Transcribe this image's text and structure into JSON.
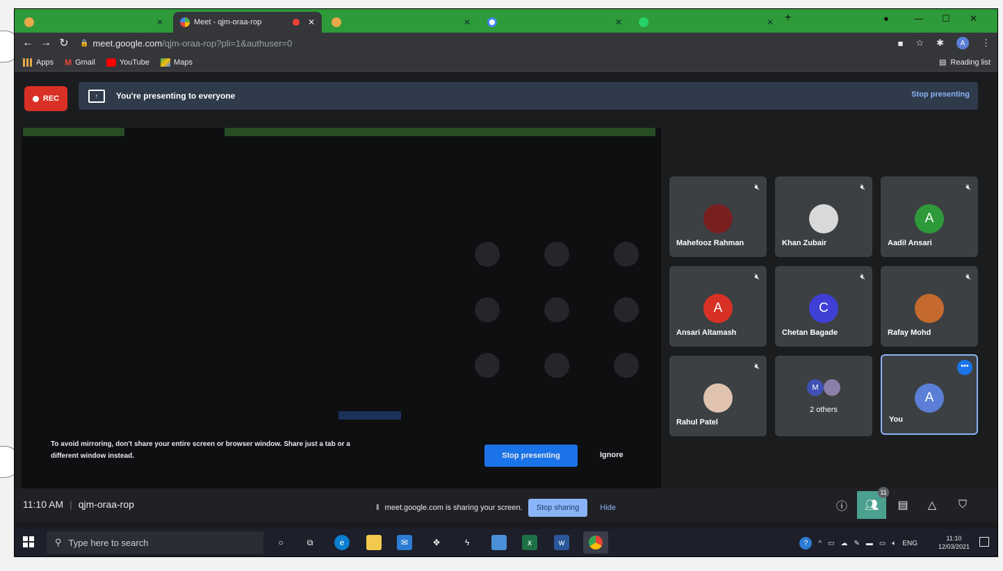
{
  "browser": {
    "tabs": [
      {
        "title": "",
        "color": "#e8a94a"
      },
      {
        "title": "Meet - qjm-oraa-rop",
        "color": "#4caf50"
      },
      {
        "title": "",
        "color": "#e8a94a"
      },
      {
        "title": "",
        "color": "#4285f4"
      },
      {
        "title": "",
        "color": "#25d366"
      }
    ],
    "new_tab": "+",
    "url_host": "meet.google.com",
    "url_path": "/qjm-oraa-rop?pli=1&authuser=0",
    "avatar_letter": "A",
    "bookmarks": [
      {
        "label": "Apps",
        "icon": "apps-grid-icon"
      },
      {
        "label": "Gmail",
        "icon": "gmail-icon"
      },
      {
        "label": "YouTube",
        "icon": "youtube-icon"
      },
      {
        "label": "Maps",
        "icon": "maps-icon"
      }
    ],
    "reading_list": "Reading list"
  },
  "meet": {
    "rec_label": "REC",
    "presenting_text": "You're presenting to everyone",
    "stop_presenting_top": "Stop presenting",
    "warning_line1": "To avoid mirroring, don't share your entire screen or browser window. Share just a tab or a",
    "warning_line2": "different window instead.",
    "stop_presenting_button": "Stop presenting",
    "ignore_button": "Ignore",
    "participants": [
      {
        "name": "Mahefooz Rahman",
        "initial": "",
        "color": "#7a1f1f"
      },
      {
        "name": "Khan Zubair",
        "initial": "",
        "color": "#d9d9d9"
      },
      {
        "name": "Aadil Ansari",
        "initial": "A",
        "color": "#2e9a3a"
      },
      {
        "name": "Ansari Altamash",
        "initial": "A",
        "color": "#d93025"
      },
      {
        "name": "Chetan Bagade",
        "initial": "C",
        "color": "#3f3fd6"
      },
      {
        "name": "Rafay Mohd",
        "initial": "",
        "color": "#c46a2e"
      },
      {
        "name": "Rahul Patel",
        "initial": "",
        "color": "#e0c2b0"
      }
    ],
    "others": {
      "label": "2 others",
      "initial": "M"
    },
    "you": {
      "name": "You",
      "initial": "A",
      "color": "#5b7fd6"
    },
    "time": "11:10 AM",
    "meeting_code": "qjm-oraa-rop",
    "sharing_text": "meet.google.com is sharing your screen.",
    "stop_sharing": "Stop sharing",
    "hide": "Hide",
    "people_count": "11"
  },
  "taskbar": {
    "search_placeholder": "Type here to search",
    "language": "ENG",
    "time": "11:10",
    "date": "12/03/2021"
  }
}
